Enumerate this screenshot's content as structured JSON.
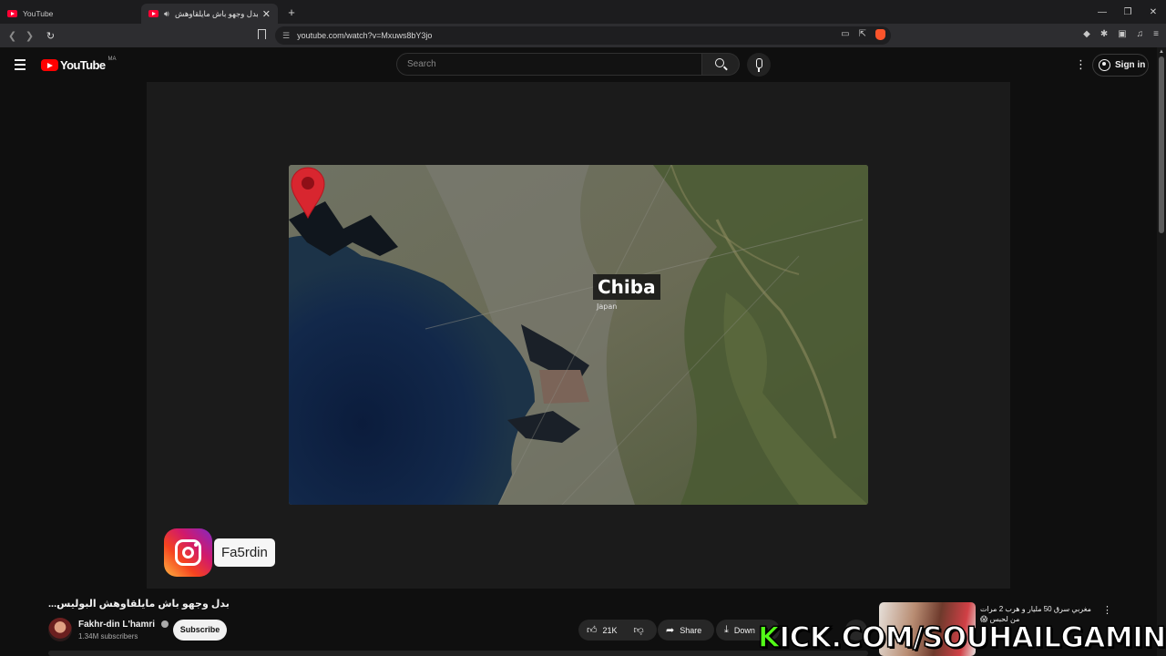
{
  "browser": {
    "tabs": [
      {
        "title": "YouTube",
        "active": false
      },
      {
        "title": "بدل وجهو باش مايلقاوهش البو",
        "active": true
      }
    ],
    "url": "youtube.com/watch?v=Mxuws8bY3jo",
    "new_tab_icon": "+",
    "window_controls": [
      "—",
      "❐",
      "✕"
    ]
  },
  "youtube": {
    "logo_text": "YouTube",
    "country_code": "MA",
    "search_placeholder": "Search",
    "signin_label": "Sign in"
  },
  "video": {
    "map_city": "Chiba",
    "map_country": "Japan",
    "instagram_handle": "Fa5rdin",
    "title": "...بدل وجهو باش مايلقاوهش البوليس"
  },
  "channel": {
    "name": "Fakhr-din L'hamri",
    "subscribers": "1.34M subscribers",
    "subscribe_label": "Subscribe"
  },
  "actions": {
    "likes": "21K",
    "share_label": "Share",
    "download_label": "Down"
  },
  "sidebar_video": {
    "title": "مغربي سرق 50 مليار و هرب 2 مرات من لحبس 😱"
  },
  "overlay_watermark": {
    "lead": "K",
    "rest": "ICK.COM/SOUHAILGAMING"
  },
  "colors": {
    "youtube_red": "#ff0000",
    "kick_green": "#53fc18",
    "pin_red": "#d8262f"
  }
}
